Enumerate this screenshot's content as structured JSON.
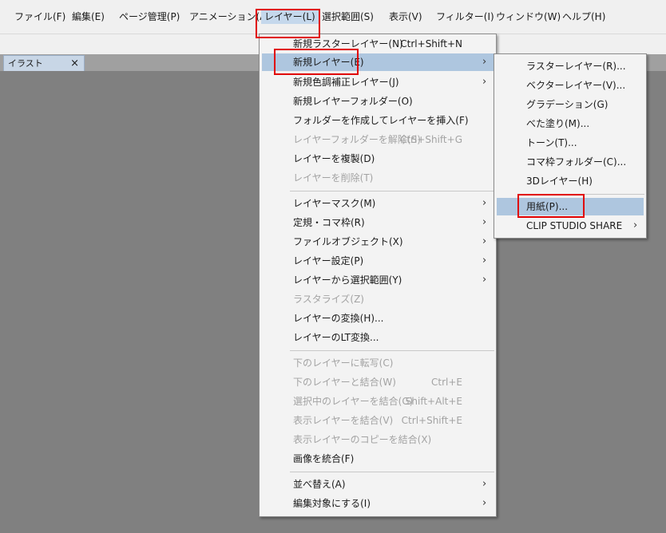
{
  "menubar": {
    "items": [
      {
        "label": "ファイル(F)"
      },
      {
        "label": "編集(E)"
      },
      {
        "label": "ページ管理(P)"
      },
      {
        "label": "アニメーション(A)"
      },
      {
        "label": "レイヤー(L)"
      },
      {
        "label": "選択範囲(S)"
      },
      {
        "label": "表示(V)"
      },
      {
        "label": "フィルター(I)"
      },
      {
        "label": "ウィンドウ(W)"
      },
      {
        "label": "ヘルプ(H)"
      }
    ]
  },
  "document_tab": {
    "label": "イラスト",
    "close": "×"
  },
  "layer_menu": {
    "items": [
      {
        "label": "新規ラスターレイヤー(N)",
        "shortcut": "Ctrl+Shift+N"
      },
      {
        "label": "新規レイヤー(E)"
      },
      {
        "label": "新規色調補正レイヤー(J)"
      },
      {
        "label": "新規レイヤーフォルダー(O)"
      },
      {
        "label": "フォルダーを作成してレイヤーを挿入(F)"
      },
      {
        "label": "レイヤーフォルダーを解除(S)",
        "shortcut": "Ctrl+Shift+G"
      },
      {
        "label": "レイヤーを複製(D)"
      },
      {
        "label": "レイヤーを削除(T)"
      },
      {
        "label": "レイヤーマスク(M)"
      },
      {
        "label": "定規・コマ枠(R)"
      },
      {
        "label": "ファイルオブジェクト(X)"
      },
      {
        "label": "レイヤー設定(P)"
      },
      {
        "label": "レイヤーから選択範囲(Y)"
      },
      {
        "label": "ラスタライズ(Z)"
      },
      {
        "label": "レイヤーの変換(H)..."
      },
      {
        "label": "レイヤーのLT変換..."
      },
      {
        "label": "下のレイヤーに転写(C)"
      },
      {
        "label": "下のレイヤーと結合(W)",
        "shortcut": "Ctrl+E"
      },
      {
        "label": "選択中のレイヤーを結合(G)",
        "shortcut": "Shift+Alt+E"
      },
      {
        "label": "表示レイヤーを結合(V)",
        "shortcut": "Ctrl+Shift+E"
      },
      {
        "label": "表示レイヤーのコピーを結合(X)"
      },
      {
        "label": "画像を統合(F)"
      },
      {
        "label": "並べ替え(A)"
      },
      {
        "label": "編集対象にする(I)"
      }
    ]
  },
  "new_layer_submenu": {
    "items": [
      {
        "label": "ラスターレイヤー(R)..."
      },
      {
        "label": "ベクターレイヤー(V)..."
      },
      {
        "label": "グラデーション(G)"
      },
      {
        "label": "べた塗り(M)..."
      },
      {
        "label": "トーン(T)..."
      },
      {
        "label": "コマ枠フォルダー(C)..."
      },
      {
        "label": "3Dレイヤー(H)"
      },
      {
        "label": "用紙(P)..."
      },
      {
        "label": "CLIP STUDIO SHARE"
      }
    ]
  },
  "colors": {
    "highlight": "#aec6df",
    "annotation_red": "#e00000",
    "canvas_gray": "#808080",
    "disabled_text": "#a3a3a3"
  }
}
